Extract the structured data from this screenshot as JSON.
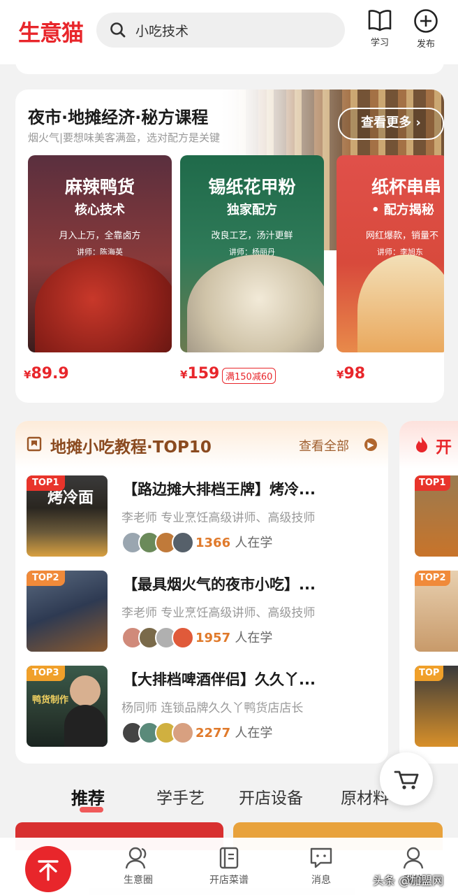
{
  "header": {
    "logo": "生意猫",
    "search_value": "小吃技术",
    "study_label": "学习",
    "publish_label": "发布"
  },
  "night_market": {
    "title": "夜市·地摊经济·秘方课程",
    "subtitle": "烟火气|要想味美客满盈，选对配方是关键",
    "more_label": "查看更多 ›",
    "courses": [
      {
        "line1": "麻辣鸭货",
        "line2": "核心技术",
        "desc": "月入上万，全靠卤方",
        "teacher": "讲师：陈海英",
        "price": "89.9",
        "price_prefix": "¥"
      },
      {
        "line1": "锡纸花甲粉",
        "line2": "独家配方",
        "desc": "改良工艺，汤汁更鲜",
        "teacher": "讲师：杨丽丹",
        "price": "159",
        "price_prefix": "¥",
        "coupon": "满150减60"
      },
      {
        "line1": "纸杯串串",
        "line2": "• 配方揭秘",
        "desc": "网红爆款，销量不",
        "teacher": "讲师：李旭东",
        "price": "98",
        "price_prefix": "¥"
      }
    ]
  },
  "top10": {
    "title": "地摊小吃教程·TOP10",
    "view_all": "查看全部",
    "people_suffix": "人在学",
    "items": [
      {
        "badge": "TOP1",
        "title": "【路边摊大排档王牌】烤冷...",
        "teacher": "李老师 专业烹饪高级讲师、高级技师",
        "count": "1366",
        "thumb_text": "烤冷面"
      },
      {
        "badge": "TOP2",
        "title": "【最具烟火气的夜市小吃】...",
        "teacher": "李老师 专业烹饪高级讲师、高级技师",
        "count": "1957"
      },
      {
        "badge": "TOP3",
        "title": "【大排档啤酒伴侣】久久丫...",
        "teacher": "杨同师 连锁品牌久久丫鸭货店店长",
        "count": "2277",
        "thumb_text": "鸭货制作"
      }
    ]
  },
  "side_card": {
    "title": "开",
    "badges": [
      "TOP1",
      "TOP2",
      "TOP"
    ]
  },
  "tabs": [
    "推荐",
    "学手艺",
    "开店设备",
    "原材料"
  ],
  "bottom_nav": [
    "生意圈",
    "开店菜谱",
    "消息",
    "我的"
  ],
  "watermark": "头条 @加盟网",
  "colors": {
    "brand": "#e8262b",
    "top10_title": "#8a4a1f",
    "learners": "#e07a2b"
  }
}
